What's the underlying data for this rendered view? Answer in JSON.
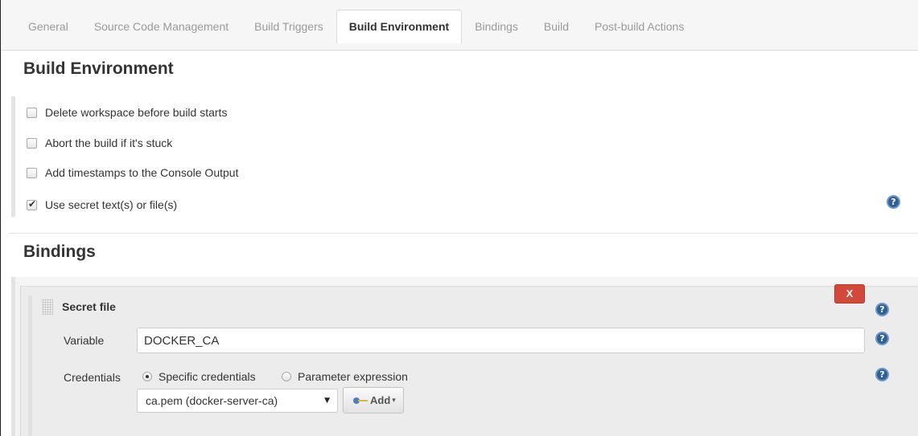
{
  "tabs": [
    {
      "label": "General",
      "active": false
    },
    {
      "label": "Source Code Management",
      "active": false
    },
    {
      "label": "Build Triggers",
      "active": false
    },
    {
      "label": "Build Environment",
      "active": true
    },
    {
      "label": "Bindings",
      "active": false
    },
    {
      "label": "Build",
      "active": false
    },
    {
      "label": "Post-build Actions",
      "active": false
    }
  ],
  "build_environment": {
    "title": "Build Environment",
    "options": [
      {
        "label": "Delete workspace before build starts",
        "checked": false
      },
      {
        "label": "Abort the build if it's stuck",
        "checked": false
      },
      {
        "label": "Add timestamps to the Console Output",
        "checked": false
      },
      {
        "label": "Use secret text(s) or file(s)",
        "checked": true
      }
    ]
  },
  "bindings": {
    "title": "Bindings",
    "secret_file": {
      "title": "Secret file",
      "delete_label": "X",
      "variable_label": "Variable",
      "variable_value": "DOCKER_CA",
      "credentials_label": "Credentials",
      "radio_specific": "Specific credentials",
      "radio_parameter": "Parameter expression",
      "selected_radio": "specific",
      "credential_selected": "ca.pem (docker-server-ca)",
      "add_label": "Add"
    }
  },
  "icons": {
    "help": "question-mark-circle-icon",
    "key": "key-icon",
    "grip": "drag-handle-icon"
  },
  "help_glyph": "?",
  "colors": {
    "delete_button": "#d24939",
    "help_icon": "#2f5f97",
    "active_tab_text": "#333333",
    "inactive_tab_text": "#9a9a9a"
  }
}
